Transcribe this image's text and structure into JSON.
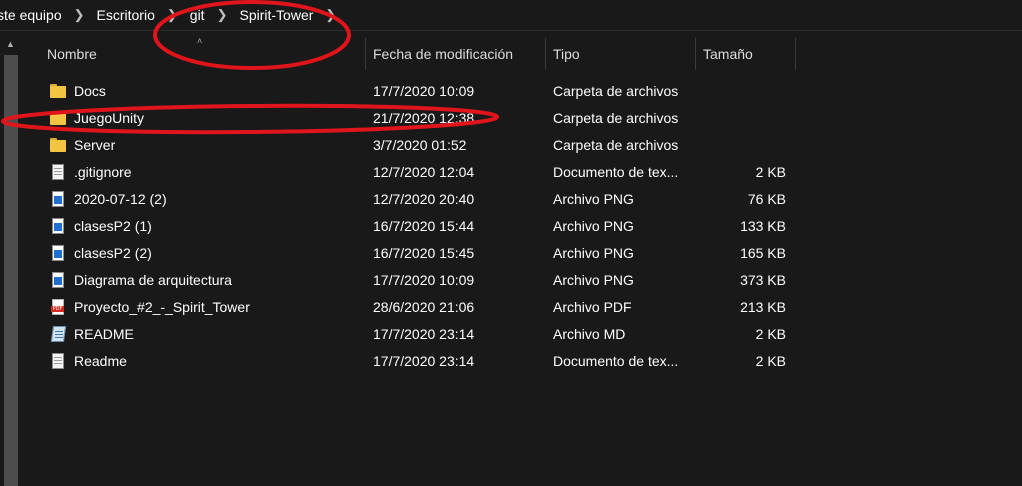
{
  "breadcrumb": {
    "items": [
      "ste equipo",
      "Escritorio",
      "git",
      "Spirit-Tower"
    ]
  },
  "columns": {
    "name": "Nombre",
    "date": "Fecha de modificación",
    "type": "Tipo",
    "size": "Tamaño"
  },
  "files": [
    {
      "name": "Docs",
      "date": "17/7/2020 10:09",
      "type": "Carpeta de archivos",
      "size": "",
      "icon": "folder-icon"
    },
    {
      "name": "JuegoUnity",
      "date": "21/7/2020 12:38",
      "type": "Carpeta de archivos",
      "size": "",
      "icon": "folder-icon"
    },
    {
      "name": "Server",
      "date": "3/7/2020 01:52",
      "type": "Carpeta de archivos",
      "size": "",
      "icon": "folder-icon"
    },
    {
      "name": ".gitignore",
      "date": "12/7/2020 12:04",
      "type": "Documento de tex...",
      "size": "2 KB",
      "icon": "text-file-icon"
    },
    {
      "name": "2020-07-12 (2)",
      "date": "12/7/2020 20:40",
      "type": "Archivo PNG",
      "size": "76 KB",
      "icon": "png-file-icon"
    },
    {
      "name": "clasesP2 (1)",
      "date": "16/7/2020 15:44",
      "type": "Archivo PNG",
      "size": "133 KB",
      "icon": "png-file-icon"
    },
    {
      "name": "clasesP2 (2)",
      "date": "16/7/2020 15:45",
      "type": "Archivo PNG",
      "size": "165 KB",
      "icon": "png-file-icon"
    },
    {
      "name": "Diagrama de arquitectura",
      "date": "17/7/2020 10:09",
      "type": "Archivo PNG",
      "size": "373 KB",
      "icon": "png-file-icon"
    },
    {
      "name": "Proyecto_#2_-_Spirit_Tower",
      "date": "28/6/2020 21:06",
      "type": "Archivo PDF",
      "size": "213 KB",
      "icon": "pdf-file-icon"
    },
    {
      "name": "README",
      "date": "17/7/2020 23:14",
      "type": "Archivo MD",
      "size": "2 KB",
      "icon": "markdown-file-icon"
    },
    {
      "name": "Readme",
      "date": "17/7/2020 23:14",
      "type": "Documento de tex...",
      "size": "2 KB",
      "icon": "text-file-icon"
    }
  ],
  "colors": {
    "background": "#191919",
    "text": "#ffffff",
    "annotation": "#e0141b"
  }
}
